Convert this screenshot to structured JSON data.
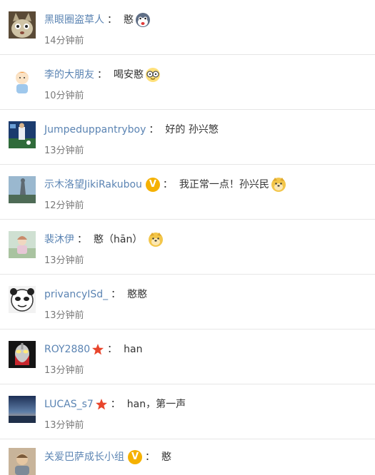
{
  "comments": [
    {
      "username": "黑眼圈盗草人",
      "text": "憨",
      "emoji": "husky-emoji",
      "time": "14分钟前",
      "avatar": "avatar-cat",
      "badge": ""
    },
    {
      "username": "李的大朋友",
      "text": "喝安憨",
      "emoji": "glasses-emoji",
      "time": "10分钟前",
      "avatar": "avatar-cartoon-boy",
      "badge": ""
    },
    {
      "username": "Jumpeduppantryboy",
      "text": "好的 孙兴慜",
      "emoji": "",
      "time": "13分钟前",
      "avatar": "avatar-football",
      "badge": ""
    },
    {
      "username": "示木洛望JikiRakubou",
      "text": "我正常一点！孙兴民",
      "emoji": "doge-emoji",
      "time": "12分钟前",
      "avatar": "avatar-landscape",
      "badge": "V"
    },
    {
      "username": "裴沐伊",
      "text": "憨（hān）",
      "emoji": "doge-emoji",
      "time": "13分钟前",
      "avatar": "avatar-illustration",
      "badge": ""
    },
    {
      "username": "privancyISd_",
      "text": "憨憨",
      "emoji": "",
      "time": "13分钟前",
      "avatar": "avatar-panda-meme",
      "badge": ""
    },
    {
      "username": "ROY2880",
      "text": "han",
      "emoji": "",
      "time": "13分钟前",
      "avatar": "avatar-ultraman",
      "badge": "star"
    },
    {
      "username": "LUCAS_s7",
      "text": "han，第一声",
      "emoji": "",
      "time": "13分钟前",
      "avatar": "avatar-sunset",
      "badge": "star"
    },
    {
      "username": "关爱巴萨成长小组",
      "text": "憨",
      "emoji": "",
      "time": "",
      "avatar": "avatar-player",
      "badge": "V"
    }
  ],
  "separator": "：",
  "colors": {
    "username": "#5b84b3",
    "text": "#333333",
    "time": "#7a7a7a",
    "divider": "#e6e6e6",
    "badge_v": "#f5b100",
    "badge_star": "#e8452c"
  }
}
